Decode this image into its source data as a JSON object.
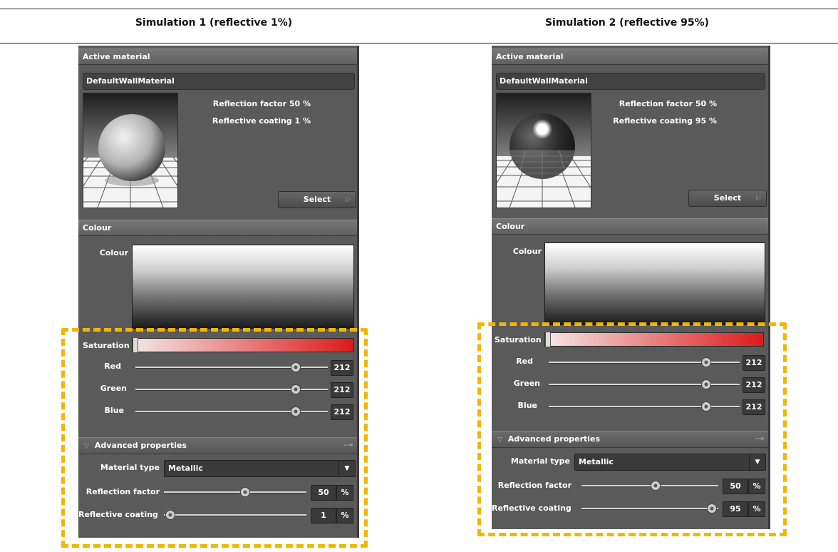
{
  "captions": {
    "left": "Simulation 1 (reflective 1%)",
    "right": "Simulation  2 (reflective 95%)"
  },
  "panels": [
    {
      "active_material_header": "Active material",
      "material_name": "DefaultWallMaterial",
      "reflection_factor_text": "Reflection factor 50 %",
      "reflective_coating_text": "Reflective coating 1 %",
      "select_label": "Select",
      "colour_header": "Colour",
      "colour_label": "Colour",
      "saturation_label": "Saturation",
      "red_label": "Red",
      "red_value": "212",
      "green_label": "Green",
      "green_value": "212",
      "blue_label": "Blue",
      "blue_value": "212",
      "advanced_header": "Advanced properties",
      "material_type_label": "Material type",
      "material_type_value": "Metallic",
      "reflection_factor_label": "Reflection factor",
      "reflection_factor_value": "50",
      "reflective_coating_label": "Reflective coating",
      "reflective_coating_value": "1",
      "pct": "%"
    },
    {
      "active_material_header": "Active material",
      "material_name": "DefaultWallMaterial",
      "reflection_factor_text": "Reflection factor 50 %",
      "reflective_coating_text": "Reflective coating 95 %",
      "select_label": "Select",
      "colour_header": "Colour",
      "colour_label": "Colour",
      "saturation_label": "Saturation",
      "red_label": "Red",
      "red_value": "212",
      "green_label": "Green",
      "green_value": "212",
      "blue_label": "Blue",
      "blue_value": "212",
      "advanced_header": "Advanced properties",
      "material_type_label": "Material type",
      "material_type_value": "Metallic",
      "reflection_factor_label": "Reflection factor",
      "reflection_factor_value": "50",
      "reflective_coating_label": "Reflective coating",
      "reflective_coating_value": "95",
      "pct": "%"
    }
  ],
  "colors": {
    "highlight_dash": "#f2b600",
    "panel_bg": "#5a5a5a"
  }
}
